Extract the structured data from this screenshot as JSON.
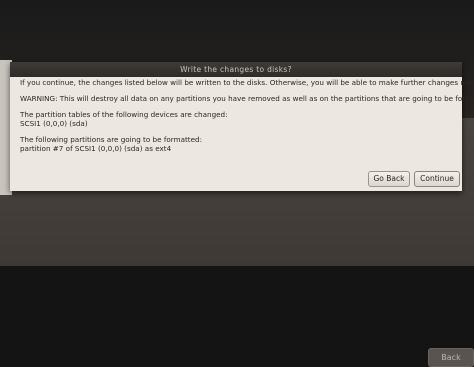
{
  "dialog": {
    "title": "Write the changes to disks?",
    "intro": "If you continue, the changes listed below will be written to the disks. Otherwise, you will be able to make further changes manually.",
    "warning": "WARNING: This will destroy all data on any partitions you have removed as well as on the partitions that are going to be formatted.",
    "tables_heading": "The partition tables of the following devices are changed:",
    "tables_device": "SCSI1 (0,0,0) (sda)",
    "format_heading": "The following partitions are going to be formatted:",
    "format_item": "partition #7 of SCSI1 (0,0,0) (sda) as ext4",
    "go_back_label": "Go Back",
    "continue_label": "Continue"
  },
  "background_window": {
    "back_label": "Back"
  }
}
